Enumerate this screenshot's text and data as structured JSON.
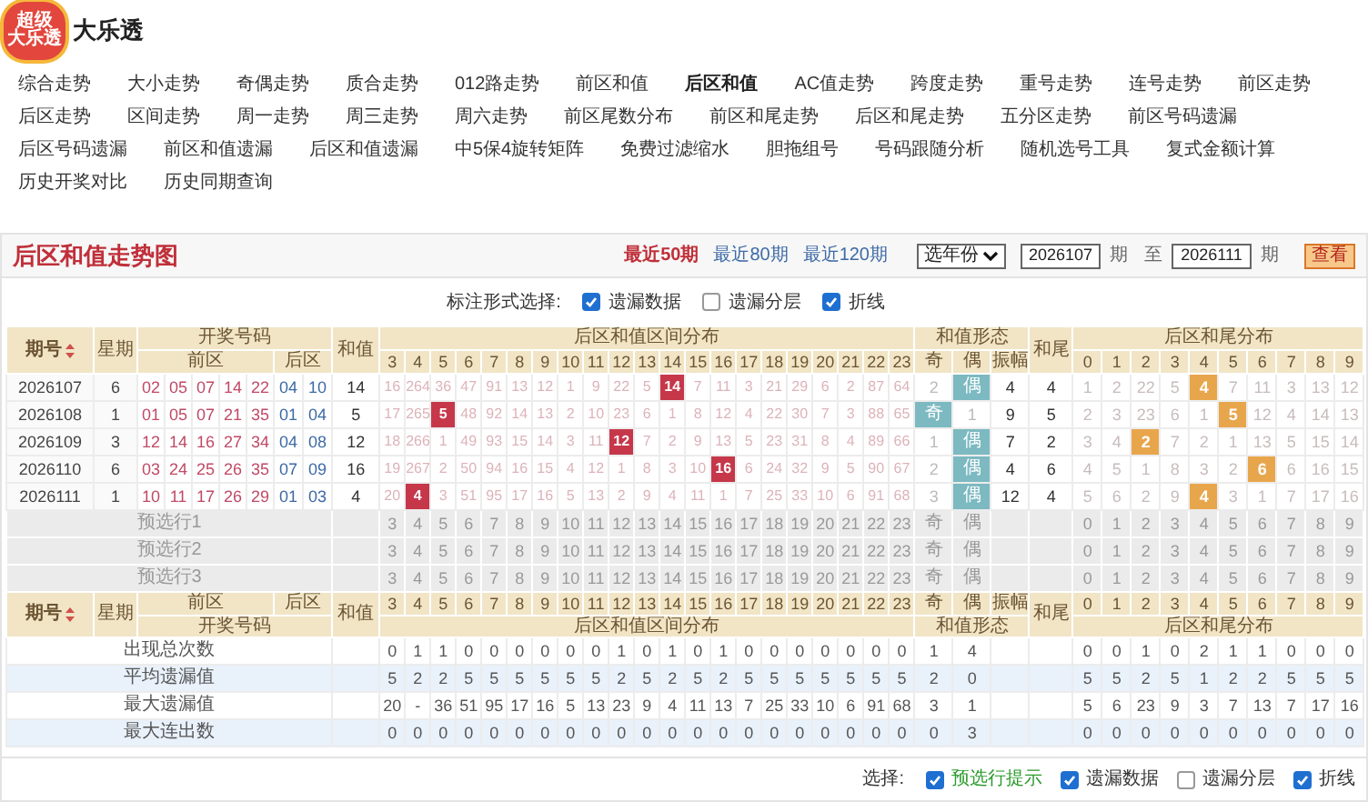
{
  "logo": {
    "lines": [
      "超级",
      "大乐透"
    ]
  },
  "site_title": "大乐透",
  "nav": [
    {
      "label": "综合走势",
      "selected": false
    },
    {
      "label": "大小走势",
      "selected": false
    },
    {
      "label": "奇偶走势",
      "selected": false
    },
    {
      "label": "质合走势",
      "selected": false
    },
    {
      "label": "012路走势",
      "selected": false
    },
    {
      "label": "前区和值",
      "selected": false
    },
    {
      "label": "后区和值",
      "selected": true
    },
    {
      "label": "AC值走势",
      "selected": false
    },
    {
      "label": "跨度走势",
      "selected": false
    },
    {
      "label": "重号走势",
      "selected": false
    },
    {
      "label": "连号走势",
      "selected": false
    },
    {
      "label": "前区走势",
      "selected": false
    },
    {
      "label": "后区走势",
      "selected": false
    },
    {
      "label": "区间走势",
      "selected": false
    },
    {
      "label": "周一走势",
      "selected": false
    },
    {
      "label": "周三走势",
      "selected": false
    },
    {
      "label": "周六走势",
      "selected": false
    },
    {
      "label": "前区尾数分布",
      "selected": false
    },
    {
      "label": "前区和尾走势",
      "selected": false
    },
    {
      "label": "后区和尾走势",
      "selected": false
    },
    {
      "label": "五分区走势",
      "selected": false
    },
    {
      "label": "前区号码遗漏",
      "selected": false
    },
    {
      "label": "后区号码遗漏",
      "selected": false
    },
    {
      "label": "前区和值遗漏",
      "selected": false
    },
    {
      "label": "后区和值遗漏",
      "selected": false
    },
    {
      "label": "中5保4旋转矩阵",
      "selected": false
    },
    {
      "label": "免费过滤缩水",
      "selected": false
    },
    {
      "label": "胆拖组号",
      "selected": false
    },
    {
      "label": "号码跟随分析",
      "selected": false
    },
    {
      "label": "随机选号工具",
      "selected": false
    },
    {
      "label": "复式金额计算",
      "selected": false
    },
    {
      "label": "历史开奖对比",
      "selected": false
    },
    {
      "label": "历史同期查询",
      "selected": false
    }
  ],
  "chart": {
    "title": "后区和值走势图",
    "periods": [
      {
        "label": "最近50期",
        "selected": true
      },
      {
        "label": "最近80期",
        "selected": false
      },
      {
        "label": "最近120期",
        "selected": false
      }
    ],
    "year_select": "选年份",
    "from": "2026107",
    "from_unit": "期",
    "to_label": "至",
    "to": "2026111",
    "to_unit": "期",
    "button": "查看"
  },
  "mark_options": {
    "label": "标注形式选择:",
    "options": [
      {
        "label": "遗漏数据",
        "checked": true
      },
      {
        "label": "遗漏分层",
        "checked": false
      },
      {
        "label": "折线",
        "checked": true
      }
    ]
  },
  "header": {
    "issue": "期号",
    "weekday": "星期",
    "draw": "开奖号码",
    "front": "前区",
    "back": "后区",
    "sum": "和值",
    "sum_dist": "后区和值区间分布",
    "sum_nums": [
      "3",
      "4",
      "5",
      "6",
      "7",
      "8",
      "9",
      "10",
      "11",
      "12",
      "13",
      "14",
      "15",
      "16",
      "17",
      "18",
      "19",
      "20",
      "21",
      "22",
      "23"
    ],
    "form": "和值形态",
    "form_cols": [
      "奇",
      "偶",
      "振幅"
    ],
    "tail": "和尾",
    "tail_dist": "后区和尾分布",
    "tail_nums": [
      "0",
      "1",
      "2",
      "3",
      "4",
      "5",
      "6",
      "7",
      "8",
      "9"
    ]
  },
  "rows": [
    {
      "issue": "2026107",
      "weekday": "6",
      "front": [
        "02",
        "05",
        "07",
        "14",
        "22"
      ],
      "back": [
        "04",
        "10"
      ],
      "sum": "14",
      "sums": [
        {
          "text": "16",
          "hit": false
        },
        {
          "text": "264",
          "hit": false
        },
        {
          "text": "36",
          "hit": false
        },
        {
          "text": "47",
          "hit": false
        },
        {
          "text": "91",
          "hit": false
        },
        {
          "text": "13",
          "hit": false
        },
        {
          "text": "12",
          "hit": false
        },
        {
          "text": "1",
          "hit": false
        },
        {
          "text": "9",
          "hit": false
        },
        {
          "text": "22",
          "hit": false
        },
        {
          "text": "5",
          "hit": false
        },
        {
          "text": "14",
          "hit": true
        },
        {
          "text": "7",
          "hit": false
        },
        {
          "text": "11",
          "hit": false
        },
        {
          "text": "3",
          "hit": false
        },
        {
          "text": "21",
          "hit": false
        },
        {
          "text": "29",
          "hit": false
        },
        {
          "text": "6",
          "hit": false
        },
        {
          "text": "2",
          "hit": false
        },
        {
          "text": "87",
          "hit": false
        },
        {
          "text": "64",
          "hit": false
        }
      ],
      "parity": [
        {
          "text": "2",
          "hit": false
        },
        {
          "text": "偶",
          "hit": true
        }
      ],
      "amplitude": "4",
      "tail": "4",
      "tails": [
        {
          "text": "1",
          "hit": false
        },
        {
          "text": "2",
          "hit": false
        },
        {
          "text": "22",
          "hit": false
        },
        {
          "text": "5",
          "hit": false
        },
        {
          "text": "4",
          "hit": true
        },
        {
          "text": "7",
          "hit": false
        },
        {
          "text": "11",
          "hit": false
        },
        {
          "text": "3",
          "hit": false
        },
        {
          "text": "13",
          "hit": false
        },
        {
          "text": "12",
          "hit": false
        }
      ]
    },
    {
      "issue": "2026108",
      "weekday": "1",
      "front": [
        "01",
        "05",
        "07",
        "21",
        "35"
      ],
      "back": [
        "01",
        "04"
      ],
      "sum": "5",
      "sums": [
        {
          "text": "17",
          "hit": false
        },
        {
          "text": "265",
          "hit": false
        },
        {
          "text": "5",
          "hit": true
        },
        {
          "text": "48",
          "hit": false
        },
        {
          "text": "92",
          "hit": false
        },
        {
          "text": "14",
          "hit": false
        },
        {
          "text": "13",
          "hit": false
        },
        {
          "text": "2",
          "hit": false
        },
        {
          "text": "10",
          "hit": false
        },
        {
          "text": "23",
          "hit": false
        },
        {
          "text": "6",
          "hit": false
        },
        {
          "text": "1",
          "hit": false
        },
        {
          "text": "8",
          "hit": false
        },
        {
          "text": "12",
          "hit": false
        },
        {
          "text": "4",
          "hit": false
        },
        {
          "text": "22",
          "hit": false
        },
        {
          "text": "30",
          "hit": false
        },
        {
          "text": "7",
          "hit": false
        },
        {
          "text": "3",
          "hit": false
        },
        {
          "text": "88",
          "hit": false
        },
        {
          "text": "65",
          "hit": false
        }
      ],
      "parity": [
        {
          "text": "奇",
          "hit": true
        },
        {
          "text": "1",
          "hit": false
        }
      ],
      "amplitude": "9",
      "tail": "5",
      "tails": [
        {
          "text": "2",
          "hit": false
        },
        {
          "text": "3",
          "hit": false
        },
        {
          "text": "23",
          "hit": false
        },
        {
          "text": "6",
          "hit": false
        },
        {
          "text": "1",
          "hit": false
        },
        {
          "text": "5",
          "hit": true
        },
        {
          "text": "12",
          "hit": false
        },
        {
          "text": "4",
          "hit": false
        },
        {
          "text": "14",
          "hit": false
        },
        {
          "text": "13",
          "hit": false
        }
      ]
    },
    {
      "issue": "2026109",
      "weekday": "3",
      "front": [
        "12",
        "14",
        "16",
        "27",
        "34"
      ],
      "back": [
        "04",
        "08"
      ],
      "sum": "12",
      "sums": [
        {
          "text": "18",
          "hit": false
        },
        {
          "text": "266",
          "hit": false
        },
        {
          "text": "1",
          "hit": false
        },
        {
          "text": "49",
          "hit": false
        },
        {
          "text": "93",
          "hit": false
        },
        {
          "text": "15",
          "hit": false
        },
        {
          "text": "14",
          "hit": false
        },
        {
          "text": "3",
          "hit": false
        },
        {
          "text": "11",
          "hit": false
        },
        {
          "text": "12",
          "hit": true
        },
        {
          "text": "7",
          "hit": false
        },
        {
          "text": "2",
          "hit": false
        },
        {
          "text": "9",
          "hit": false
        },
        {
          "text": "13",
          "hit": false
        },
        {
          "text": "5",
          "hit": false
        },
        {
          "text": "23",
          "hit": false
        },
        {
          "text": "31",
          "hit": false
        },
        {
          "text": "8",
          "hit": false
        },
        {
          "text": "4",
          "hit": false
        },
        {
          "text": "89",
          "hit": false
        },
        {
          "text": "66",
          "hit": false
        }
      ],
      "parity": [
        {
          "text": "1",
          "hit": false
        },
        {
          "text": "偶",
          "hit": true
        }
      ],
      "amplitude": "7",
      "tail": "2",
      "tails": [
        {
          "text": "3",
          "hit": false
        },
        {
          "text": "4",
          "hit": false
        },
        {
          "text": "2",
          "hit": true
        },
        {
          "text": "7",
          "hit": false
        },
        {
          "text": "2",
          "hit": false
        },
        {
          "text": "1",
          "hit": false
        },
        {
          "text": "13",
          "hit": false
        },
        {
          "text": "5",
          "hit": false
        },
        {
          "text": "15",
          "hit": false
        },
        {
          "text": "14",
          "hit": false
        }
      ]
    },
    {
      "issue": "2026110",
      "weekday": "6",
      "front": [
        "03",
        "24",
        "25",
        "26",
        "35"
      ],
      "back": [
        "07",
        "09"
      ],
      "sum": "16",
      "sums": [
        {
          "text": "19",
          "hit": false
        },
        {
          "text": "267",
          "hit": false
        },
        {
          "text": "2",
          "hit": false
        },
        {
          "text": "50",
          "hit": false
        },
        {
          "text": "94",
          "hit": false
        },
        {
          "text": "16",
          "hit": false
        },
        {
          "text": "15",
          "hit": false
        },
        {
          "text": "4",
          "hit": false
        },
        {
          "text": "12",
          "hit": false
        },
        {
          "text": "1",
          "hit": false
        },
        {
          "text": "8",
          "hit": false
        },
        {
          "text": "3",
          "hit": false
        },
        {
          "text": "10",
          "hit": false
        },
        {
          "text": "16",
          "hit": true
        },
        {
          "text": "6",
          "hit": false
        },
        {
          "text": "24",
          "hit": false
        },
        {
          "text": "32",
          "hit": false
        },
        {
          "text": "9",
          "hit": false
        },
        {
          "text": "5",
          "hit": false
        },
        {
          "text": "90",
          "hit": false
        },
        {
          "text": "67",
          "hit": false
        }
      ],
      "parity": [
        {
          "text": "2",
          "hit": false
        },
        {
          "text": "偶",
          "hit": true
        }
      ],
      "amplitude": "4",
      "tail": "6",
      "tails": [
        {
          "text": "4",
          "hit": false
        },
        {
          "text": "5",
          "hit": false
        },
        {
          "text": "1",
          "hit": false
        },
        {
          "text": "8",
          "hit": false
        },
        {
          "text": "3",
          "hit": false
        },
        {
          "text": "2",
          "hit": false
        },
        {
          "text": "6",
          "hit": true
        },
        {
          "text": "6",
          "hit": false
        },
        {
          "text": "16",
          "hit": false
        },
        {
          "text": "15",
          "hit": false
        }
      ]
    },
    {
      "issue": "2026111",
      "weekday": "1",
      "front": [
        "10",
        "11",
        "17",
        "26",
        "29"
      ],
      "back": [
        "01",
        "03"
      ],
      "sum": "4",
      "sums": [
        {
          "text": "20",
          "hit": false
        },
        {
          "text": "4",
          "hit": true
        },
        {
          "text": "3",
          "hit": false
        },
        {
          "text": "51",
          "hit": false
        },
        {
          "text": "95",
          "hit": false
        },
        {
          "text": "17",
          "hit": false
        },
        {
          "text": "16",
          "hit": false
        },
        {
          "text": "5",
          "hit": false
        },
        {
          "text": "13",
          "hit": false
        },
        {
          "text": "2",
          "hit": false
        },
        {
          "text": "9",
          "hit": false
        },
        {
          "text": "4",
          "hit": false
        },
        {
          "text": "11",
          "hit": false
        },
        {
          "text": "1",
          "hit": false
        },
        {
          "text": "7",
          "hit": false
        },
        {
          "text": "25",
          "hit": false
        },
        {
          "text": "33",
          "hit": false
        },
        {
          "text": "10",
          "hit": false
        },
        {
          "text": "6",
          "hit": false
        },
        {
          "text": "91",
          "hit": false
        },
        {
          "text": "68",
          "hit": false
        }
      ],
      "parity": [
        {
          "text": "3",
          "hit": false
        },
        {
          "text": "偶",
          "hit": true
        }
      ],
      "amplitude": "12",
      "tail": "4",
      "tails": [
        {
          "text": "5",
          "hit": false
        },
        {
          "text": "6",
          "hit": false
        },
        {
          "text": "2",
          "hit": false
        },
        {
          "text": "9",
          "hit": false
        },
        {
          "text": "4",
          "hit": true
        },
        {
          "text": "3",
          "hit": false
        },
        {
          "text": "1",
          "hit": false
        },
        {
          "text": "7",
          "hit": false
        },
        {
          "text": "17",
          "hit": false
        },
        {
          "text": "16",
          "hit": false
        }
      ]
    }
  ],
  "preselect_rows": [
    {
      "label": "预选行1",
      "sums": [
        "3",
        "4",
        "5",
        "6",
        "7",
        "8",
        "9",
        "10",
        "11",
        "12",
        "13",
        "14",
        "15",
        "16",
        "17",
        "18",
        "19",
        "20",
        "21",
        "22",
        "23"
      ],
      "parity": [
        "奇",
        "偶"
      ],
      "tails": [
        "0",
        "1",
        "2",
        "3",
        "4",
        "5",
        "6",
        "7",
        "8",
        "9"
      ]
    },
    {
      "label": "预选行2",
      "sums": [
        "3",
        "4",
        "5",
        "6",
        "7",
        "8",
        "9",
        "10",
        "11",
        "12",
        "13",
        "14",
        "15",
        "16",
        "17",
        "18",
        "19",
        "20",
        "21",
        "22",
        "23"
      ],
      "parity": [
        "奇",
        "偶"
      ],
      "tails": [
        "0",
        "1",
        "2",
        "3",
        "4",
        "5",
        "6",
        "7",
        "8",
        "9"
      ]
    },
    {
      "label": "预选行3",
      "sums": [
        "3",
        "4",
        "5",
        "6",
        "7",
        "8",
        "9",
        "10",
        "11",
        "12",
        "13",
        "14",
        "15",
        "16",
        "17",
        "18",
        "19",
        "20",
        "21",
        "22",
        "23"
      ],
      "parity": [
        "奇",
        "偶"
      ],
      "tails": [
        "0",
        "1",
        "2",
        "3",
        "4",
        "5",
        "6",
        "7",
        "8",
        "9"
      ]
    }
  ],
  "footer_header": {
    "issue": "期号",
    "weekday": "星期",
    "draw": "开奖号码",
    "front": "前区",
    "back": "后区",
    "sum": "和值",
    "sum_dist": "后区和值区间分布",
    "sum_nums": [
      "3",
      "4",
      "5",
      "6",
      "7",
      "8",
      "9",
      "10",
      "11",
      "12",
      "13",
      "14",
      "15",
      "16",
      "17",
      "18",
      "19",
      "20",
      "21",
      "22",
      "23"
    ],
    "form": "和值形态",
    "form_cols": [
      "奇",
      "偶",
      "振幅"
    ],
    "tail": "和尾",
    "tail_dist": "后区和尾分布",
    "tail_nums": [
      "0",
      "1",
      "2",
      "3",
      "4",
      "5",
      "6",
      "7",
      "8",
      "9"
    ]
  },
  "stats": [
    {
      "label": "出现总次数",
      "sums": [
        "0",
        "1",
        "1",
        "0",
        "0",
        "0",
        "0",
        "0",
        "0",
        "1",
        "0",
        "1",
        "0",
        "1",
        "0",
        "0",
        "0",
        "0",
        "0",
        "0",
        "0"
      ],
      "parity": [
        "1",
        "4"
      ],
      "tails": [
        "0",
        "0",
        "1",
        "0",
        "2",
        "1",
        "1",
        "0",
        "0",
        "0"
      ]
    },
    {
      "label": "平均遗漏值",
      "sums": [
        "5",
        "2",
        "2",
        "5",
        "5",
        "5",
        "5",
        "5",
        "5",
        "2",
        "5",
        "2",
        "5",
        "2",
        "5",
        "5",
        "5",
        "5",
        "5",
        "5",
        "5"
      ],
      "parity": [
        "2",
        "0"
      ],
      "tails": [
        "5",
        "5",
        "2",
        "5",
        "1",
        "2",
        "2",
        "5",
        "5",
        "5"
      ]
    },
    {
      "label": "最大遗漏值",
      "sums": [
        "20",
        "-",
        "36",
        "51",
        "95",
        "17",
        "16",
        "5",
        "13",
        "23",
        "9",
        "4",
        "11",
        "13",
        "7",
        "25",
        "33",
        "10",
        "6",
        "91",
        "68"
      ],
      "parity": [
        "3",
        "1"
      ],
      "tails": [
        "5",
        "6",
        "23",
        "9",
        "3",
        "7",
        "13",
        "7",
        "17",
        "16"
      ]
    },
    {
      "label": "最大连出数",
      "sums": [
        "0",
        "0",
        "0",
        "0",
        "0",
        "0",
        "0",
        "0",
        "0",
        "0",
        "0",
        "0",
        "0",
        "0",
        "0",
        "0",
        "0",
        "0",
        "0",
        "0",
        "0"
      ],
      "parity": [
        "0",
        "3"
      ],
      "tails": [
        "0",
        "0",
        "0",
        "0",
        "0",
        "0",
        "0",
        "0",
        "0",
        "0"
      ]
    }
  ],
  "bottom_options": {
    "label": "选择:",
    "options": [
      {
        "label": "预选行提示",
        "checked": true,
        "color": "#2a9a2a"
      },
      {
        "label": "遗漏数据",
        "checked": true,
        "color": "#333333"
      },
      {
        "label": "遗漏分层",
        "checked": false,
        "color": "#333333"
      },
      {
        "label": "折线",
        "checked": true,
        "color": "#333333"
      }
    ]
  }
}
